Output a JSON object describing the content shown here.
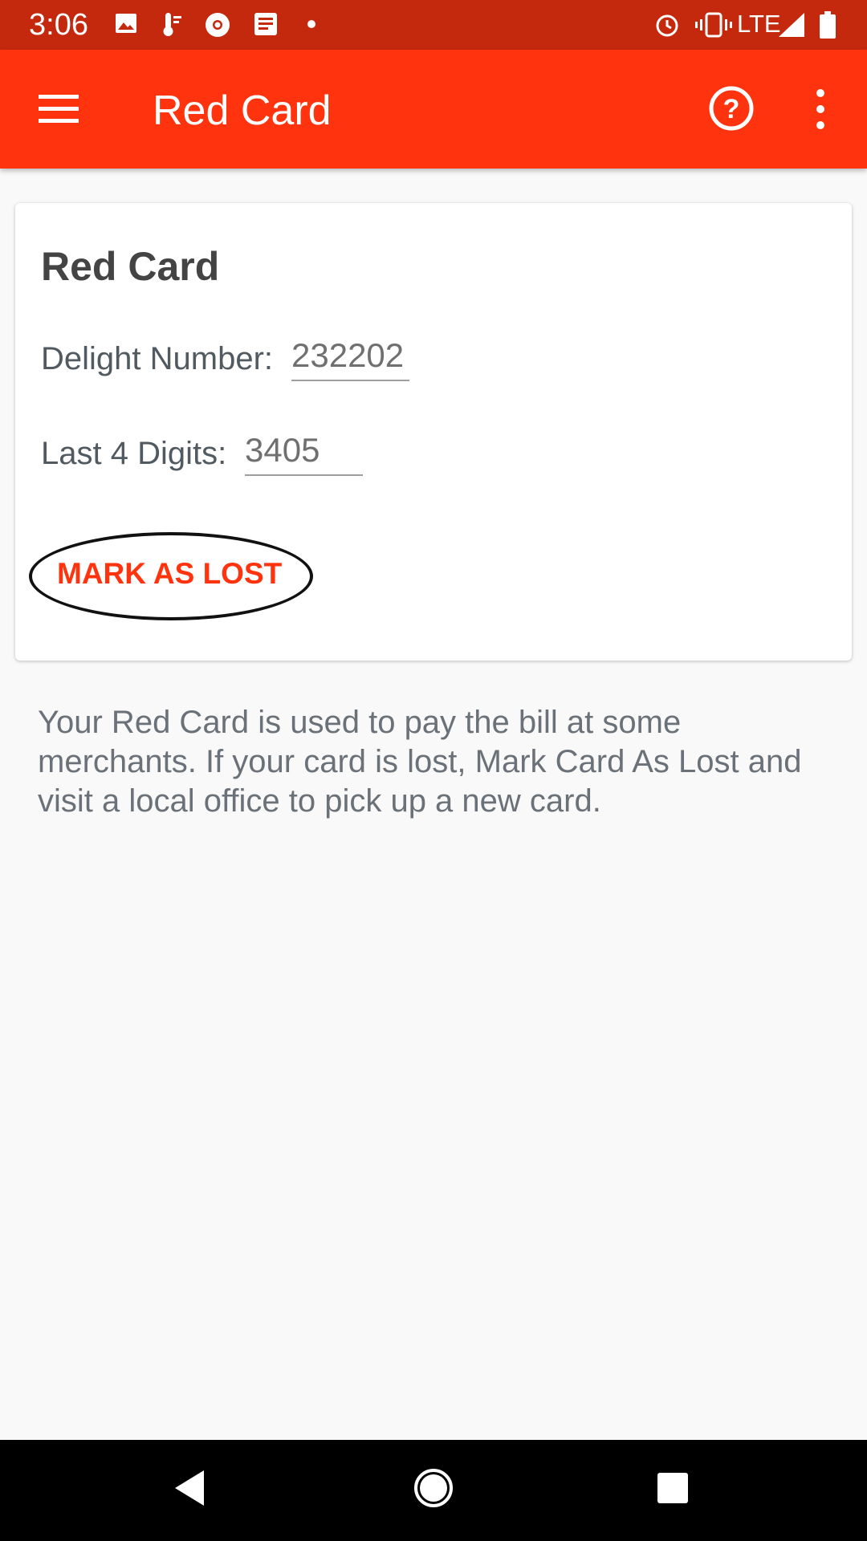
{
  "status_bar": {
    "time": "3:06",
    "network": "LTE",
    "icons": [
      "image-icon",
      "thermometer-icon",
      "chrome-icon",
      "news-icon",
      "dot-icon",
      "alarm-icon",
      "vibrate-icon",
      "signal-icon",
      "battery-icon"
    ]
  },
  "app_bar": {
    "title": "Red Card",
    "menu_icon": "menu-icon",
    "help_icon": "help-icon",
    "more_icon": "more-vert-icon",
    "color": "#ff330d"
  },
  "card": {
    "title": "Red Card",
    "delight_label": "Delight Number:",
    "delight_value": "232202",
    "last4_label": "Last 4 Digits:",
    "last4_value": "3405",
    "mark_lost_label": "MARK AS LOST"
  },
  "description": "Your Red Card is used to pay the bill at some merchants. If your card is lost, Mark Card As Lost and visit a local office to pick up a new card.",
  "nav_bar": {
    "icons": [
      "back-icon",
      "home-icon",
      "recents-icon"
    ]
  }
}
